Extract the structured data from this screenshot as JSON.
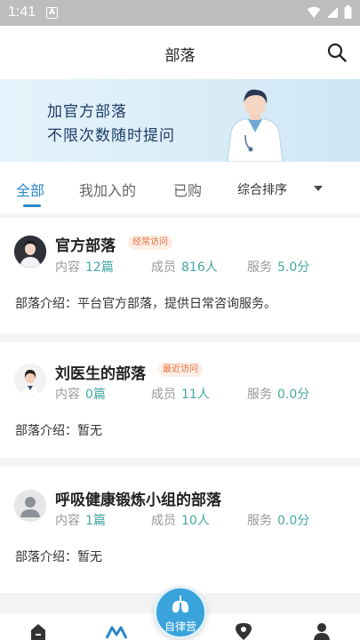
{
  "status_bar": {
    "time": "1:41",
    "notification_glyph": "A"
  },
  "header": {
    "title": "部落"
  },
  "banner": {
    "line1": "加官方部落",
    "line2": "不限次数随时提问"
  },
  "tabs": [
    {
      "label": "全部",
      "active": true
    },
    {
      "label": "我加入的",
      "active": false
    },
    {
      "label": "已购",
      "active": false
    }
  ],
  "sort": {
    "label": "综合排序"
  },
  "tribes": [
    {
      "name": "官方部落",
      "badge": "经常访问",
      "content_label": "内容",
      "content_value": "12篇",
      "members_label": "成员",
      "members_value": "816人",
      "service_label": "服务",
      "service_value": "5.0分",
      "intro": "部落介绍：平台官方部落，提供日常咨询服务。"
    },
    {
      "name": "刘医生的部落",
      "badge": "最近访问",
      "content_label": "内容",
      "content_value": "0篇",
      "members_label": "成员",
      "members_value": "11人",
      "service_label": "服务",
      "service_value": "0.0分",
      "intro": "部落介绍：暂无"
    },
    {
      "name": "呼吸健康锻炼小组的部落",
      "badge": "",
      "content_label": "内容",
      "content_value": "1篇",
      "members_label": "成员",
      "members_value": "10人",
      "service_label": "服务",
      "service_value": "0.0分",
      "intro": "部落介绍：暂无"
    }
  ],
  "fab": {
    "label": "自律营"
  },
  "colors": {
    "accent": "#2a86c8",
    "stat_value": "#45a7a3",
    "badge_text": "#e9713f",
    "fab": "#3aa3dc"
  }
}
